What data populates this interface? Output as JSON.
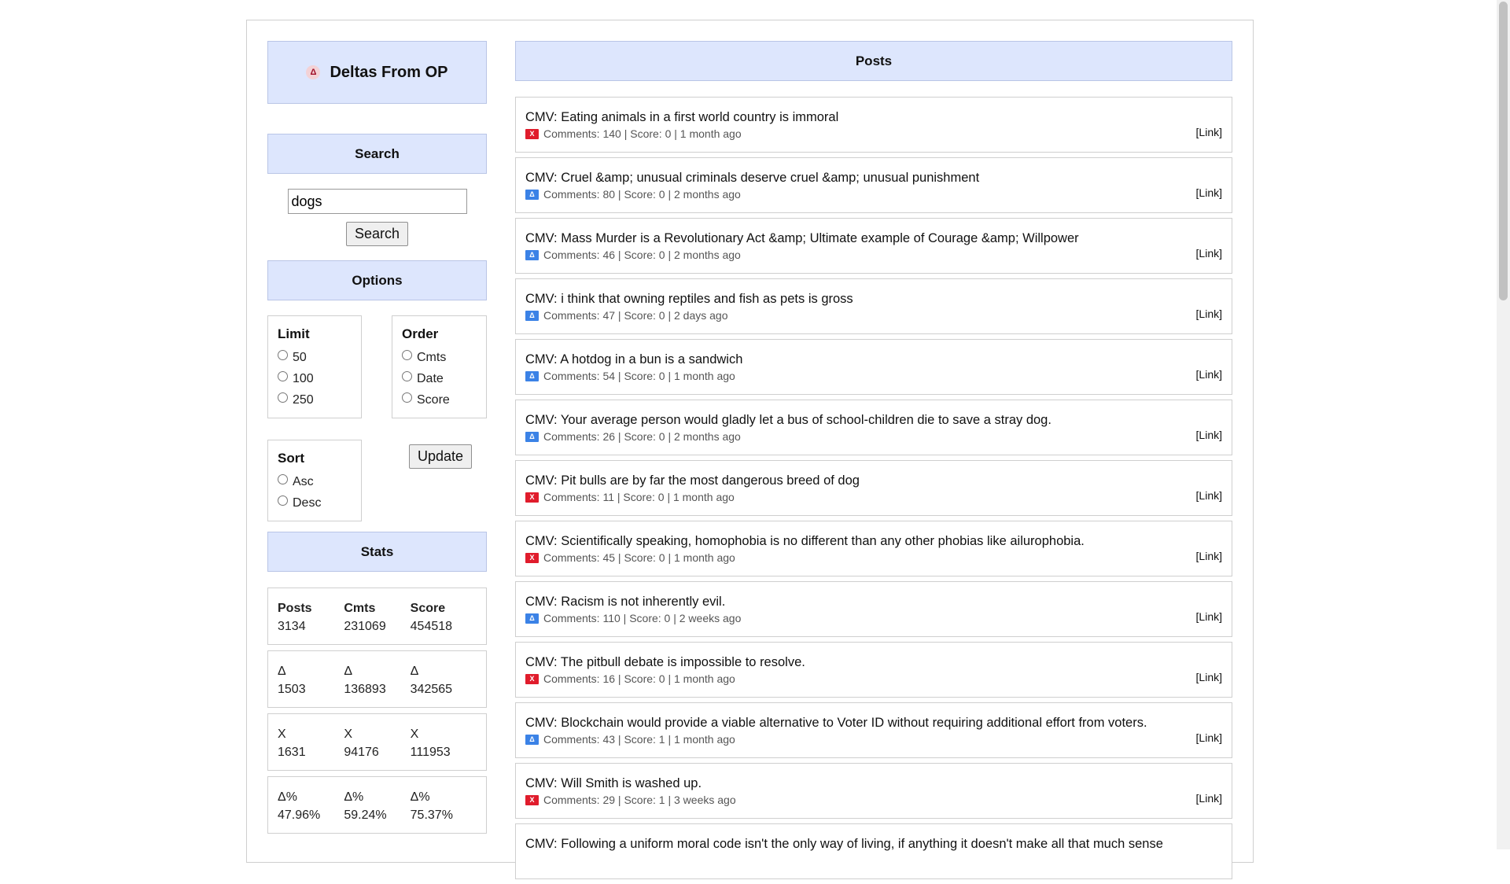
{
  "brand": {
    "title": "Deltas From OP",
    "logo_glyph": "Δ"
  },
  "search": {
    "heading": "Search",
    "value": "dogs",
    "button": "Search"
  },
  "options": {
    "heading": "Options",
    "limit": {
      "legend": "Limit",
      "items": [
        "50",
        "100",
        "250"
      ]
    },
    "order": {
      "legend": "Order",
      "items": [
        "Cmts",
        "Date",
        "Score"
      ]
    },
    "sort": {
      "legend": "Sort",
      "items": [
        "Asc",
        "Desc"
      ]
    },
    "update_button": "Update"
  },
  "stats": {
    "heading": "Stats",
    "rows": [
      [
        {
          "h": "Posts",
          "v": "3134"
        },
        {
          "h": "Cmts",
          "v": "231069"
        },
        {
          "h": "Score",
          "v": "454518"
        }
      ],
      [
        {
          "h": "Δ",
          "v": "1503"
        },
        {
          "h": "Δ",
          "v": "136893"
        },
        {
          "h": "Δ",
          "v": "342565"
        }
      ],
      [
        {
          "h": "X",
          "v": "1631"
        },
        {
          "h": "X",
          "v": "94176"
        },
        {
          "h": "X",
          "v": "111953"
        }
      ],
      [
        {
          "h": "Δ%",
          "v": "47.96%"
        },
        {
          "h": "Δ%",
          "v": "59.24%"
        },
        {
          "h": "Δ%",
          "v": "75.37%"
        }
      ]
    ]
  },
  "posts": {
    "heading": "Posts",
    "link_label": "[Link]",
    "items": [
      {
        "title": "CMV: Eating animals in a first world country is immoral",
        "badge": "x",
        "meta": "Comments: 140 | Score: 0 | 1 month ago"
      },
      {
        "title": "CMV: Cruel &amp; unusual criminals deserve cruel &amp; unusual punishment",
        "badge": "delta",
        "meta": "Comments: 80 | Score: 0 | 2 months ago"
      },
      {
        "title": "CMV: Mass Murder is a Revolutionary Act &amp; Ultimate example of Courage &amp; Willpower",
        "badge": "delta",
        "meta": "Comments: 46 | Score: 0 | 2 months ago"
      },
      {
        "title": "CMV: i think that owning reptiles and fish as pets is gross",
        "badge": "delta",
        "meta": "Comments: 47 | Score: 0 | 2 days ago"
      },
      {
        "title": "CMV: A hotdog in a bun is a sandwich",
        "badge": "delta",
        "meta": "Comments: 54 | Score: 0 | 1 month ago"
      },
      {
        "title": "CMV: Your average person would gladly let a bus of school-children die to save a stray dog.",
        "badge": "delta",
        "meta": "Comments: 26 | Score: 0 | 2 months ago"
      },
      {
        "title": "CMV: Pit bulls are by far the most dangerous breed of dog",
        "badge": "x",
        "meta": "Comments: 11 | Score: 0 | 1 month ago"
      },
      {
        "title": "CMV: Scientifically speaking, homophobia is no different than any other phobias like ailurophobia.",
        "badge": "x",
        "meta": "Comments: 45 | Score: 0 | 1 month ago"
      },
      {
        "title": "CMV: Racism is not inherently evil.",
        "badge": "delta",
        "meta": "Comments: 110 | Score: 0 | 2 weeks ago"
      },
      {
        "title": "CMV: The pitbull debate is impossible to resolve.",
        "badge": "x",
        "meta": "Comments: 16 | Score: 0 | 1 month ago"
      },
      {
        "title": "CMV: Blockchain would provide a viable alternative to Voter ID without requiring additional effort from voters.",
        "badge": "delta",
        "meta": "Comments: 43 | Score: 1 | 1 month ago"
      },
      {
        "title": "CMV: Will Smith is washed up.",
        "badge": "x",
        "meta": "Comments: 29 | Score: 1 | 3 weeks ago"
      },
      {
        "title": "CMV: Following a uniform moral code isn't the only way of living, if anything it doesn't make all that much sense",
        "badge": "delta",
        "meta": ""
      }
    ]
  },
  "badge_glyphs": {
    "delta": "Δ",
    "x": "X"
  },
  "colors": {
    "header_bg": "#dde6fd",
    "delta_badge": "#3b82e6",
    "x_badge": "#e01c2c"
  }
}
